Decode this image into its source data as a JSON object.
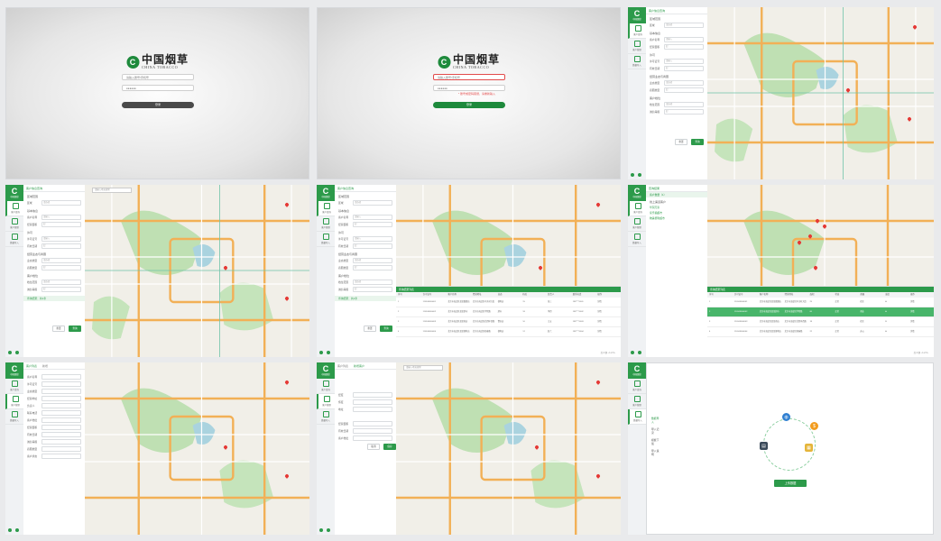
{
  "brand": {
    "cn": "中国烟草",
    "en": "CHINA TOBACCO",
    "mark": "C",
    "rail_text": "中国烟草"
  },
  "login": {
    "username_placeholder": "请输入账号/手机号",
    "password_value": "●●●●●●",
    "error_text": "* 账号或密码错误，请重新输入",
    "button_label": "登录",
    "button_color_default": "#4a4a4a",
    "button_color_active": "#1e8a3c"
  },
  "rail": {
    "items": [
      "客户查询",
      "客户管理",
      "数据导入"
    ]
  },
  "side_a": {
    "tab": "客户信息查询",
    "sections": [
      {
        "title": "区域范围",
        "rows": [
          {
            "label": "区域",
            "value": "请选择"
          }
        ]
      },
      {
        "title": "基本信息",
        "rows": [
          {
            "label": "客户名称",
            "value": "请输入"
          },
          {
            "label": "经营面积",
            "value": "起"
          }
        ]
      },
      {
        "title": "许可",
        "rows": [
          {
            "label": "许可证号",
            "value": "请输入"
          },
          {
            "label": "有效日期",
            "value": "起"
          }
        ]
      },
      {
        "title": "经营业态与商圈",
        "rows": [
          {
            "label": "业态类型",
            "value": "请选择"
          },
          {
            "label": "商圈类型",
            "value": "起"
          }
        ]
      },
      {
        "title": "客户档位",
        "rows": [
          {
            "label": "档位范围",
            "value": "请选择"
          },
          {
            "label": "诚信等级",
            "value": "起"
          }
        ]
      }
    ],
    "reset": "重置",
    "search": "查询",
    "result_tag": "查询结果：共1条"
  },
  "side_b": {
    "tab": "查询结果",
    "result": "客户数量（1）",
    "group_title": "线上渠道客户",
    "checks": [
      "华润万家",
      "家乐福超市",
      "物美便利超市"
    ]
  },
  "side_c": {
    "tabs": [
      "客户列表",
      "新增"
    ],
    "rows": [
      "客户名称",
      "许可证号",
      "业态类型",
      "经营地址",
      "负责人",
      "联系电话",
      "客户档位",
      "经营面积",
      "有效日期",
      "诚信等级",
      "商圈类型",
      "客户状态"
    ]
  },
  "side_d": {
    "tabs": [
      "客户列表",
      "新增客户"
    ],
    "rows": [
      "经度",
      "纬度",
      "地址",
      "经营面积",
      "有效日期",
      "客户档位"
    ],
    "save": "保存",
    "cancel": "取消"
  },
  "map": {
    "search_placeholder": "请输入地址搜索",
    "bg": "#f1efe8"
  },
  "table": {
    "title": "查询结果列表",
    "columns": [
      "序号",
      "许可证号",
      "客户名称",
      "经营地址",
      "业态",
      "档位",
      "负责人",
      "联系电话",
      "面积",
      "状态",
      "商圈",
      "诚信",
      "操作"
    ],
    "rows": [
      [
        "1",
        "110108000001",
        "北京市海淀区某某烟酒店",
        "北京市海淀区中关村大街",
        "便利店",
        "15",
        "张三",
        "138****0001",
        "25",
        "正常",
        "社区",
        "A",
        "详情"
      ],
      [
        "2",
        "110108000002",
        "北京市海淀区某某超市",
        "北京市海淀区学院路",
        "超市",
        "18",
        "李四",
        "138****0002",
        "60",
        "正常",
        "商业",
        "A",
        "详情"
      ],
      [
        "3",
        "110108000003",
        "北京市海淀区某某商店",
        "北京市海淀区北四环西路",
        "食杂店",
        "10",
        "王五",
        "138****0003",
        "18",
        "正常",
        "社区",
        "B",
        "详情"
      ],
      [
        "4",
        "110108000004",
        "北京市海淀区某某便利店",
        "北京市海淀区知春路",
        "便利店",
        "12",
        "赵六",
        "138****0004",
        "22",
        "正常",
        "办公",
        "A",
        "详情"
      ]
    ],
    "pager": "共 4 条  ‹ 1 2 3 ›"
  },
  "upload": {
    "button": "上传数据",
    "list": [
      "数据导入",
      "导入记录",
      "模板下载",
      "导入说明"
    ]
  }
}
